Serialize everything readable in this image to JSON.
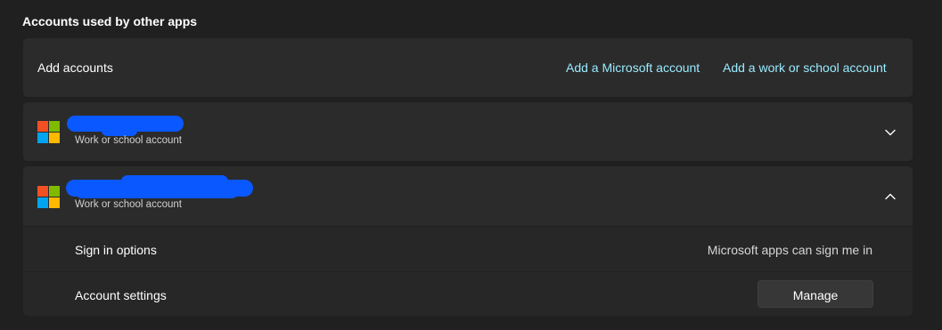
{
  "section": {
    "title": "Accounts used by other apps"
  },
  "add_accounts": {
    "label": "Add accounts",
    "microsoft_link": "Add a Microsoft account",
    "work_link": "Add a work or school account"
  },
  "accounts": [
    {
      "name": "",
      "type": "Work or school account",
      "expanded": false,
      "chevron_icon": "chevron-down-icon"
    },
    {
      "name": "",
      "type": "Work or school account",
      "expanded": true,
      "chevron_icon": "chevron-up-icon",
      "options": {
        "sign_in_label": "Sign in options",
        "sign_in_value": "Microsoft apps can sign me in",
        "settings_label": "Account settings",
        "manage_button": "Manage"
      }
    }
  ],
  "colors": {
    "background": "#202020",
    "card": "#2b2b2b",
    "link": "#99ebff",
    "redaction": "#0a58ff",
    "logo_red": "#f25022",
    "logo_green": "#7fba00",
    "logo_blue": "#00a4ef",
    "logo_yellow": "#ffb900"
  }
}
